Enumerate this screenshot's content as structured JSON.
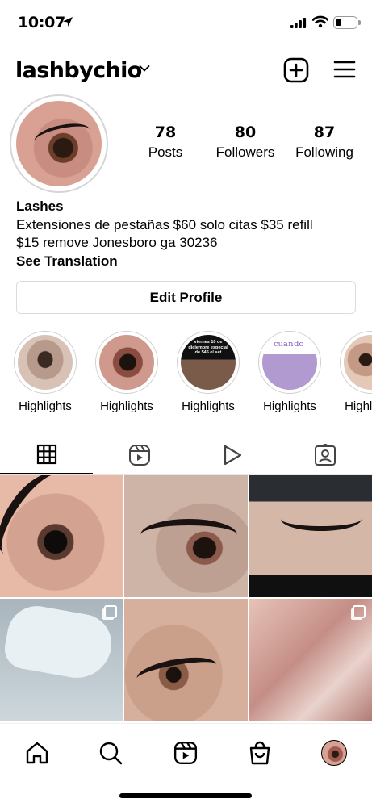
{
  "status_bar": {
    "time": "10:07"
  },
  "header": {
    "username": "lashbychio"
  },
  "profile": {
    "stats": [
      {
        "value": "78",
        "label": "Posts"
      },
      {
        "value": "80",
        "label": "Followers"
      },
      {
        "value": "87",
        "label": "Following"
      }
    ],
    "name": "Lashes",
    "bio_line1": "Extensiones de pestañas $60 solo citas $35 refill",
    "bio_line2": "$15 remove Jonesboro ga 30236",
    "see_translation": "See Translation",
    "edit_profile": "Edit Profile"
  },
  "highlights": [
    {
      "label": "Highlights"
    },
    {
      "label": "Highlights",
      "cover_text": ""
    },
    {
      "label": "Highlights",
      "cover_text": "viernes 10 de diciembre especial de $45 el set"
    },
    {
      "label": "Highlights"
    },
    {
      "label": "Highlights"
    }
  ],
  "tabs": [
    "grid-icon",
    "reels-icon",
    "play-icon",
    "tagged-icon"
  ],
  "nav": [
    "home-icon",
    "search-icon",
    "reels-icon",
    "shop-icon",
    "profile-avatar"
  ]
}
